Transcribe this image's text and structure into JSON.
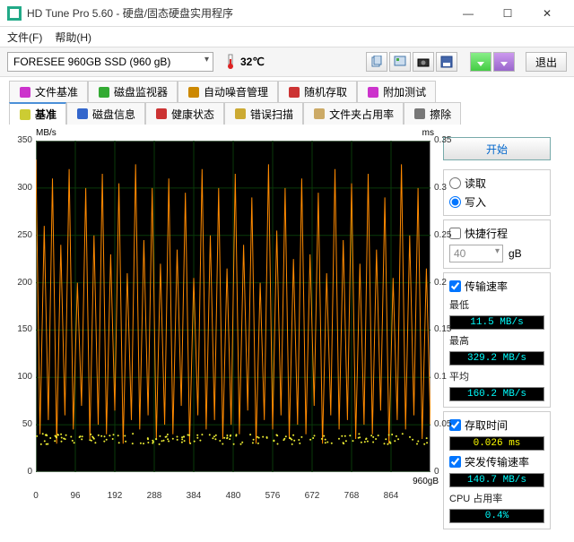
{
  "window": {
    "title": "HD Tune Pro 5.60 - 硬盘/固态硬盘实用程序"
  },
  "menu": {
    "file": "文件(F)",
    "help": "帮助(H)"
  },
  "toolbar": {
    "device": "FORESEE 960GB SSD (960 gB)",
    "temp_value": "32℃",
    "exit": "退出"
  },
  "tabs_top": [
    {
      "label": "文件基准",
      "icon": "file-benchmark-icon"
    },
    {
      "label": "磁盘监视器",
      "icon": "disk-monitor-icon"
    },
    {
      "label": "自动噪音管理",
      "icon": "aam-icon"
    },
    {
      "label": "随机存取",
      "icon": "random-icon"
    },
    {
      "label": "附加测试",
      "icon": "extra-icon"
    }
  ],
  "tabs_bottom": [
    {
      "label": "基准",
      "icon": "benchmark-icon",
      "active": true
    },
    {
      "label": "磁盘信息",
      "icon": "disk-info-icon"
    },
    {
      "label": "健康状态",
      "icon": "health-icon"
    },
    {
      "label": "错误扫描",
      "icon": "error-scan-icon"
    },
    {
      "label": "文件夹占用率",
      "icon": "folder-usage-icon"
    },
    {
      "label": "擦除",
      "icon": "erase-icon"
    }
  ],
  "side": {
    "start": "开始",
    "read": "读取",
    "write": "写入",
    "mode_selected": "write",
    "short_stroke": "快捷行程",
    "short_stroke_checked": false,
    "short_stroke_value": "40",
    "short_stroke_unit": "gB",
    "transfer_rate": "传输速率",
    "transfer_rate_checked": true,
    "min_label": "最低",
    "min_value": "11.5 MB/s",
    "max_label": "最高",
    "max_value": "329.2 MB/s",
    "avg_label": "平均",
    "avg_value": "160.2 MB/s",
    "access_time": "存取时间",
    "access_time_checked": true,
    "access_value": "0.026 ms",
    "burst_rate": "突发传输速率",
    "burst_rate_checked": true,
    "burst_value": "140.7 MB/s",
    "cpu_label": "CPU 占用率",
    "cpu_value": "0.4%"
  },
  "chart_data": {
    "type": "line",
    "title": "",
    "x_unit": "960gB",
    "y_left_unit": "MB/s",
    "y_right_unit": "ms",
    "x_ticks": [
      0,
      96,
      192,
      288,
      384,
      480,
      576,
      672,
      768,
      864
    ],
    "y_left_ticks": [
      0,
      50,
      100,
      150,
      200,
      250,
      300,
      350
    ],
    "y_right_ticks": [
      0,
      0.05,
      0.1,
      0.15,
      0.2,
      0.25,
      0.3,
      0.35
    ],
    "y_left_range": [
      0,
      350
    ],
    "y_right_range": [
      0,
      0.35
    ],
    "x_range": [
      0,
      960
    ],
    "series": [
      {
        "name": "transfer_rate_MBps",
        "axis": "left",
        "color": "#ff8a00",
        "summary": {
          "min": 11.5,
          "max": 329.2,
          "avg": 160.2
        },
        "values_sample": [
          330,
          40,
          260,
          55,
          310,
          30,
          240,
          60,
          320,
          45,
          200,
          70,
          300,
          35,
          250,
          50,
          315,
          40,
          230,
          65,
          305,
          30,
          210,
          55,
          325,
          45,
          245,
          60,
          300,
          35,
          220,
          50,
          310,
          40,
          235,
          70,
          295,
          30,
          205,
          60,
          320,
          45,
          250,
          55,
          300,
          35,
          215,
          50,
          315,
          40,
          240,
          65,
          290,
          30,
          200,
          55,
          325,
          45,
          255,
          60,
          300,
          35,
          225,
          50,
          310,
          40,
          230,
          70,
          295,
          30,
          210,
          60,
          320,
          45,
          245,
          55,
          305,
          35,
          220,
          50,
          315,
          40,
          235,
          65,
          290,
          30,
          205,
          55,
          325,
          45,
          250,
          60,
          300,
          35,
          215,
          50
        ]
      },
      {
        "name": "access_time_ms",
        "axis": "right",
        "color": "#eeee33",
        "summary": {
          "value": 0.026
        },
        "baseline_approx": 0.035
      }
    ]
  }
}
